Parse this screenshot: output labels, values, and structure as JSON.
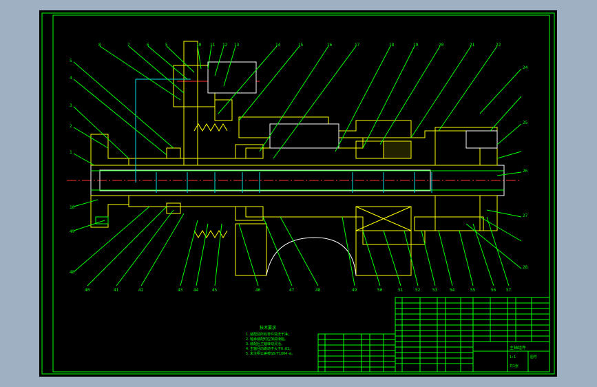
{
  "drawing": {
    "colors": {
      "frame": "#00ff00",
      "outline": "#ffffff",
      "hatch": "#ffff00",
      "centerline": "#ff3030",
      "hidden": "#00e0e0",
      "background": "#000000"
    },
    "top_callouts": [
      "8",
      "7",
      "6",
      "5",
      "10",
      "11",
      "12",
      "13",
      "14",
      "15",
      "16",
      "17",
      "18",
      "19",
      "20",
      "21",
      "22"
    ],
    "left_callouts": [
      "5",
      "4",
      "3",
      "2",
      "1"
    ],
    "right_callouts": [
      "24",
      "25",
      "26",
      "27",
      "28"
    ],
    "bottom_callouts": [
      "40",
      "41",
      "42",
      "43",
      "44",
      "45",
      "46",
      "47",
      "48",
      "49",
      "50",
      "51",
      "52",
      "53",
      "54",
      "55",
      "56",
      "57",
      "58"
    ],
    "left_lower_callouts": [
      "10",
      "49",
      "48"
    ],
    "notes_title": "技术要求",
    "notes_lines": [
      "1.装配前所有零件清洗干净。",
      "2.轴承装配时应加润滑脂。",
      "3.装配后主轴转动灵活。",
      "4.主轴径向跳动不大于0.01。",
      "5.未注明公差按GB/T1804-m。"
    ],
    "title_block": {
      "name": "主轴组件",
      "drawing_no": "图号",
      "scale": "1:1",
      "sheet": "共1张"
    }
  }
}
